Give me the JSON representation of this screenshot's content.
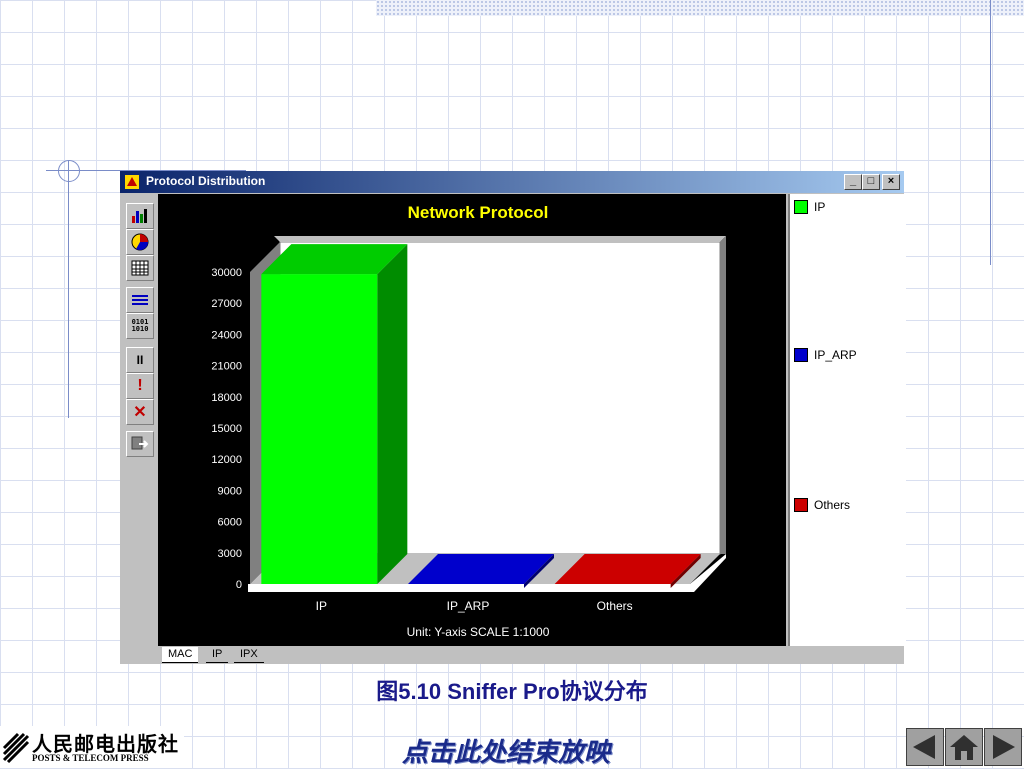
{
  "window": {
    "title": "Protocol Distribution",
    "controls": {
      "minimize": "_",
      "maximize": "□",
      "close": "×"
    }
  },
  "toolbar": {
    "tools": [
      {
        "name": "bar-chart-icon"
      },
      {
        "name": "pie-chart-icon"
      },
      {
        "name": "table-icon"
      },
      {
        "name": "detail-icon"
      },
      {
        "name": "binary-icon",
        "label": "0101 1010"
      },
      {
        "name": "pause-icon",
        "label": "II"
      },
      {
        "name": "alert-icon",
        "label": "!"
      },
      {
        "name": "stop-icon",
        "label": "✕"
      },
      {
        "name": "export-icon"
      }
    ]
  },
  "chart_data": {
    "type": "bar",
    "title": "Network Protocol",
    "categories": [
      "IP",
      "IP_ARP",
      "Others"
    ],
    "values": [
      29800,
      0,
      0
    ],
    "colors": [
      "#00ff00",
      "#0000cc",
      "#cc0000"
    ],
    "ylim": [
      0,
      30000
    ],
    "yticks": [
      0,
      3000,
      6000,
      9000,
      12000,
      15000,
      18000,
      21000,
      24000,
      27000,
      30000
    ],
    "footer": "Unit:  Y-axis SCALE 1:1000",
    "legend_position": "right"
  },
  "legend": [
    {
      "label": "IP",
      "color": "#00ff00"
    },
    {
      "label": "IP_ARP",
      "color": "#0000cc"
    },
    {
      "label": "Others",
      "color": "#cc0000"
    }
  ],
  "tabs": [
    {
      "label": "MAC",
      "active": true
    },
    {
      "label": "IP",
      "active": false
    },
    {
      "label": "IPX",
      "active": false
    }
  ],
  "caption": "图5.10  Sniffer Pro协议分布",
  "publisher": {
    "cn": "人民邮电出版社",
    "en": "POSTS & TELECOM PRESS"
  },
  "end_show": "点击此处结束放映",
  "nav": [
    {
      "name": "prev"
    },
    {
      "name": "home"
    },
    {
      "name": "next"
    }
  ]
}
